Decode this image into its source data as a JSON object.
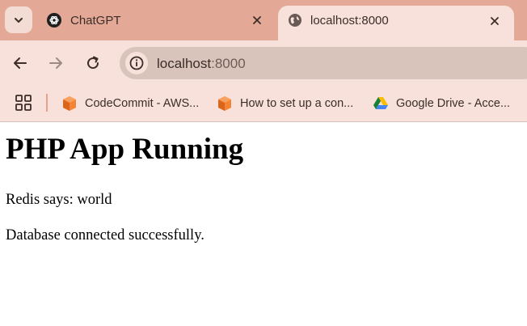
{
  "tabs": [
    {
      "title": "ChatGPT",
      "favicon": "chatgpt-icon",
      "active": false
    },
    {
      "title": "localhost:8000",
      "favicon": "globe-icon",
      "active": true
    }
  ],
  "toolbar": {
    "url_host": "localhost",
    "url_port": ":8000"
  },
  "bookmarks": [
    {
      "label": "CodeCommit - AWS...",
      "icon": "aws-cube-icon"
    },
    {
      "label": "How to set up a con...",
      "icon": "aws-cube-icon"
    },
    {
      "label": "Google Drive - Acce...",
      "icon": "google-drive-icon"
    }
  ],
  "page": {
    "heading": "PHP App Running",
    "line1": "Redis says: world",
    "line2": "Database connected successfully."
  },
  "colors": {
    "tabstrip": "#e3a896",
    "toolbar": "#f7e1da",
    "omnibox": "#d8c4bb",
    "aws_orange": "#f58536"
  }
}
